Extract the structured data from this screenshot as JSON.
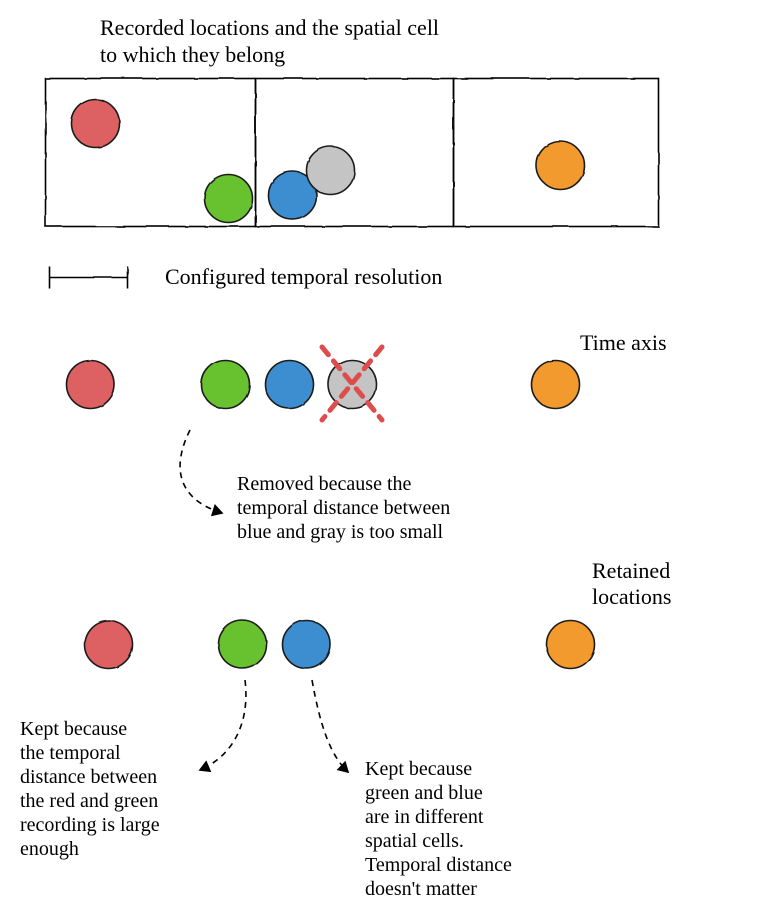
{
  "title": {
    "line1": "Recorded locations and the spatial cell",
    "line2": "to which they belong"
  },
  "temporal_label": "Configured temporal resolution",
  "time_axis_label": "Time axis",
  "retained_label1": "Retained",
  "retained_label2": "locations",
  "removed_annot": {
    "l1": "Removed because the",
    "l2": "temporal distance between",
    "l3": "blue and gray is too small"
  },
  "kept_green_annot": {
    "l1": "Kept because",
    "l2": "the temporal",
    "l3": "distance between",
    "l4": "the red and green",
    "l5": "recording is large",
    "l6": "enough"
  },
  "kept_blue_annot": {
    "l1": "Kept because",
    "l2": "green and blue",
    "l3": "are in different",
    "l4": "spatial cells.",
    "l5": "Temporal distance",
    "l6": "doesn't matter"
  },
  "colors": {
    "red": "#dd6162",
    "green": "#67c12f",
    "blue": "#3d8ed0",
    "gray": "#c4c4c4",
    "orange": "#f29a2e",
    "cross": "#dd4d4d",
    "stroke": "#1a1a1a"
  },
  "nodes": {
    "red": {
      "name": "red-location"
    },
    "green": {
      "name": "green-location"
    },
    "blue": {
      "name": "blue-location"
    },
    "gray": {
      "name": "gray-location"
    },
    "orange": {
      "name": "orange-location"
    }
  }
}
